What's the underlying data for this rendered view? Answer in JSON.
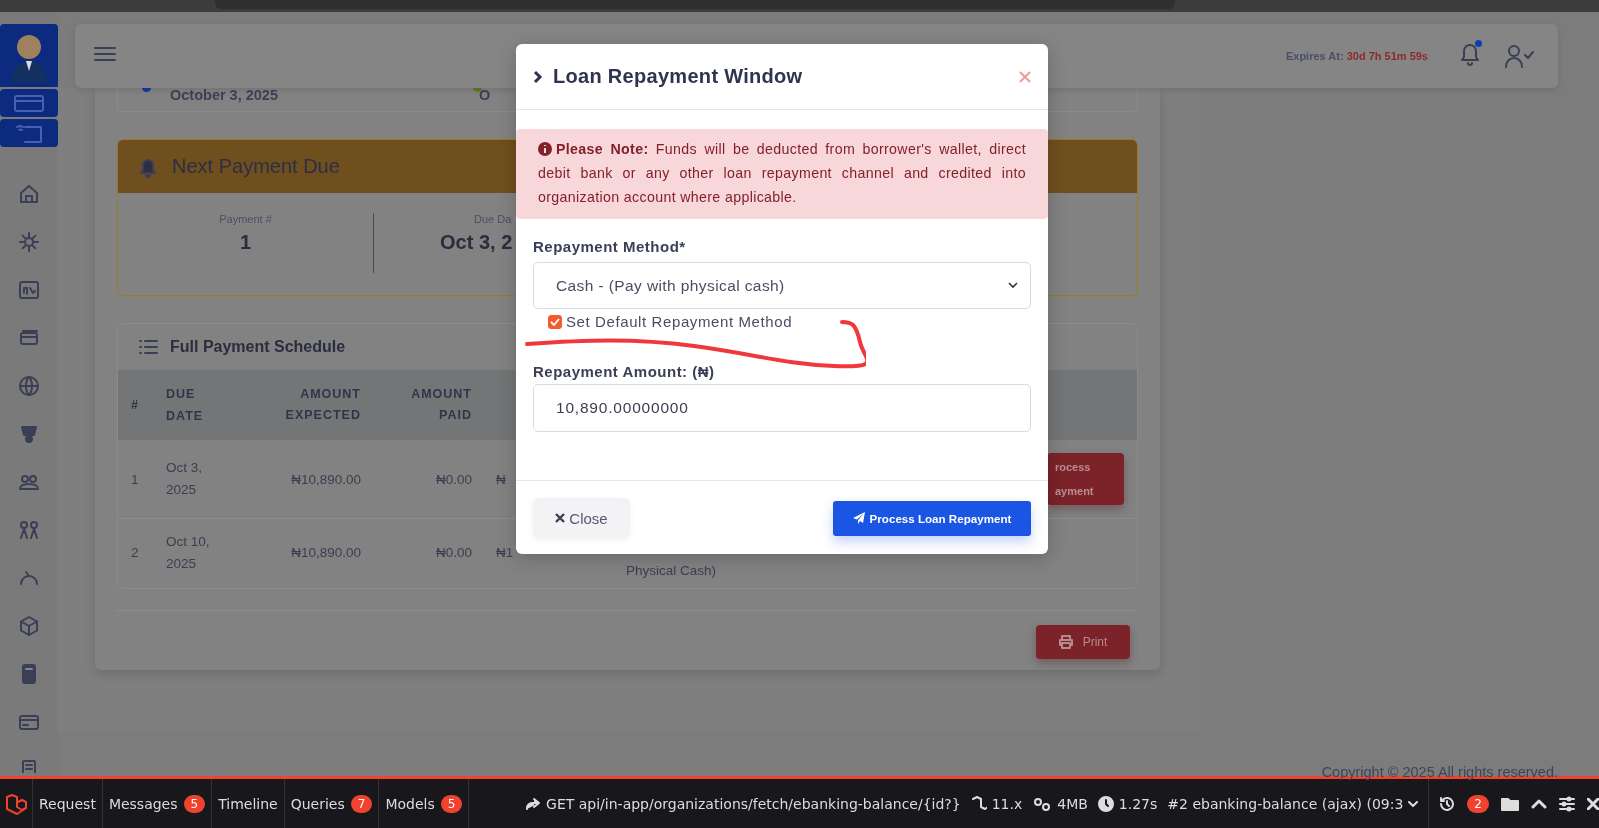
{
  "header": {
    "expires_label": "Expires At:",
    "expires_value": "30d 7h 51m 59s",
    "notification_dot": true
  },
  "loan_info": {
    "start_date": "October 3, 2025",
    "column_2": "O"
  },
  "next_payment": {
    "title": "Next Payment Due",
    "items": [
      {
        "label": "Payment #",
        "value": "1"
      },
      {
        "label": "Due Da",
        "value": "Oct 3, 2"
      }
    ]
  },
  "schedule": {
    "title": "Full Payment Schedule",
    "columns": [
      "#",
      "DUE DATE",
      "AMOUNT EXPECTED",
      "AMOUNT PAID"
    ],
    "rows": [
      {
        "number": "1",
        "due_date": "Oct 3, 2025",
        "amount_expected": "₦10,890.00",
        "amount_paid": "₦0.00",
        "column_5": "₦",
        "action_lines": [
          "rocess",
          "ayment"
        ]
      },
      {
        "number": "2",
        "due_date": "Oct 10, 2025",
        "amount_expected": "₦10,890.00",
        "amount_paid": "₦0.00",
        "column_5": "₦1",
        "column_6": "Physical Cash)"
      }
    ],
    "print_button": "Print"
  },
  "copyright": "Copyright © 2025 All rights reserved.",
  "modal": {
    "title": "Loan Repayment Window",
    "alert": "**Please Note:** Funds will be deducted from borrower's wallet, direct debit bank or any other loan repayment channel and credited into organization account where applicable.",
    "method_label": "Repayment Method*",
    "method_value": "Cash - (Pay with physical cash)",
    "default_checkbox": {
      "label": "Set Default Repayment Method",
      "checked": true
    },
    "amount_label": "Repayment Amount: (₦)",
    "amount_value": "10,890.00000000",
    "buttons": [
      {
        "label": "Close",
        "kind": "secondary"
      },
      {
        "label": "Process Loan Repayment",
        "kind": "primary"
      }
    ]
  },
  "debug_bar": {
    "tabs": [
      {
        "label": "Request",
        "selected": false
      },
      {
        "label": "Messages",
        "count": "5",
        "selected": false
      },
      {
        "label": "Timeline",
        "selected": false
      },
      {
        "label": "Queries",
        "count": "7",
        "selected": false
      },
      {
        "label": "Models",
        "count": "5",
        "selected": false
      }
    ],
    "route": "GET api/in-app/organizations/fetch/ebanking-balance/{id?}",
    "version": "11.x",
    "memory": "4MB",
    "duration": "1.27s",
    "request": "#2 ebanking-balance (ajax) (09:3",
    "history_count": "2"
  }
}
